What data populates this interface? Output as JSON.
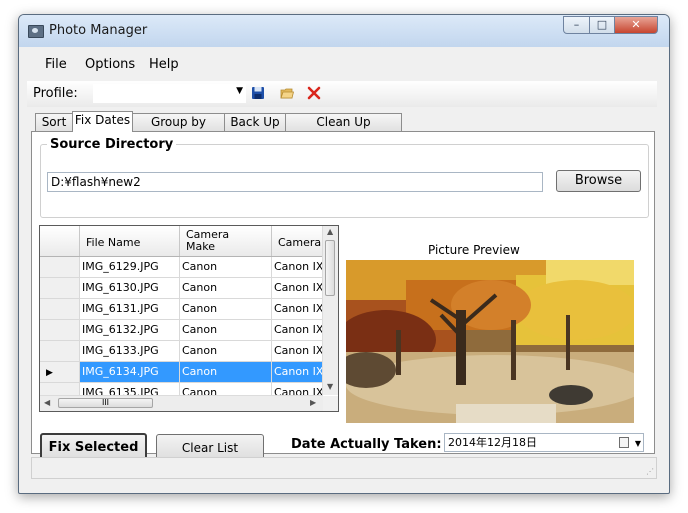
{
  "window": {
    "title": "Photo Manager",
    "controls": {
      "minimize": "–",
      "maximize": "□",
      "close": "✕"
    }
  },
  "menu": {
    "items": [
      "File",
      "Options",
      "Help"
    ]
  },
  "toolbar": {
    "profile_label": "Profile:",
    "profile_value": "",
    "icons": [
      "save-icon",
      "open-folder-icon",
      "delete-icon"
    ]
  },
  "tabs": [
    "Sort",
    "Fix Dates",
    "Group by Event",
    "Back Up",
    "Clean Up Duplicates"
  ],
  "active_tab": "Fix Dates",
  "source": {
    "title": "Source Directory",
    "path": "D:¥flash¥new2",
    "browse_label": "Browse"
  },
  "grid": {
    "columns": [
      "File Name",
      "Camera Make",
      "Camera"
    ],
    "rows": [
      {
        "file": "IMG_6129.JPG",
        "make": "Canon",
        "model": "Canon IX"
      },
      {
        "file": "IMG_6130.JPG",
        "make": "Canon",
        "model": "Canon IX"
      },
      {
        "file": "IMG_6131.JPG",
        "make": "Canon",
        "model": "Canon IX"
      },
      {
        "file": "IMG_6132.JPG",
        "make": "Canon",
        "model": "Canon IX"
      },
      {
        "file": "IMG_6133.JPG",
        "make": "Canon",
        "model": "Canon IX"
      },
      {
        "file": "IMG_6134.JPG",
        "make": "Canon",
        "model": "Canon IX"
      },
      {
        "file": "IMG_6135.JPG",
        "make": "Canon",
        "model": "Canon IX"
      }
    ],
    "selected_row": 5,
    "hscroll_grip": "III"
  },
  "preview": {
    "label": "Picture Preview"
  },
  "actions": {
    "fix_label": "Fix Selected",
    "clear_label": "Clear List",
    "date_label": "Date Actually Taken:",
    "date_value": "2014年12月18日"
  },
  "colors": {
    "selection": "#3399ff",
    "accent_close": "#c7452f"
  }
}
